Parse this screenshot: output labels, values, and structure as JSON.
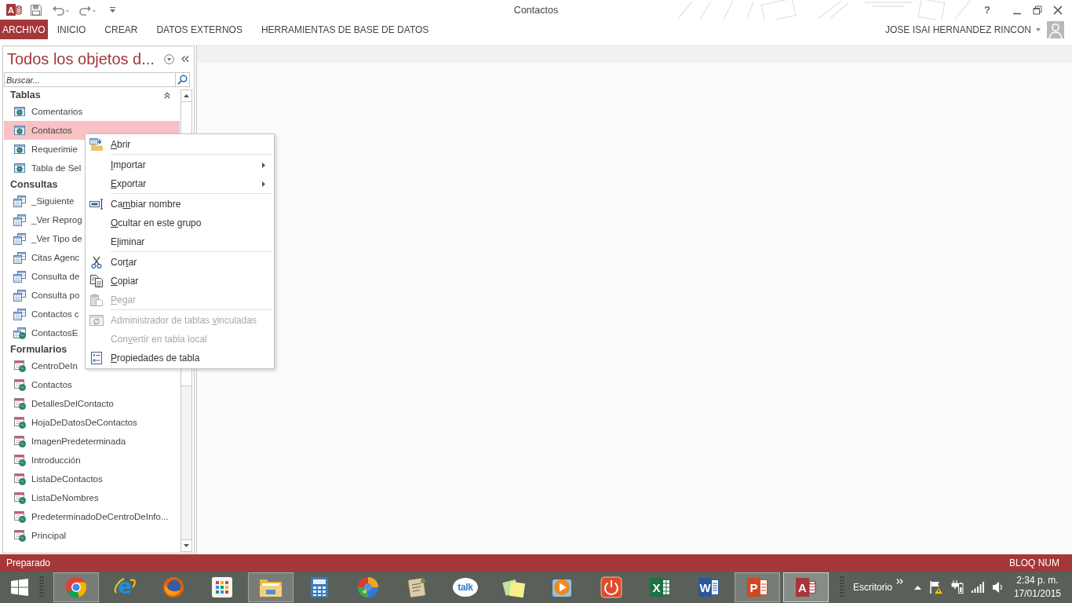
{
  "window": {
    "title": "Contactos",
    "help": "?",
    "app_glyph": "A"
  },
  "ribbon": {
    "tabs": [
      {
        "label": "ARCHIVO",
        "kind": "file"
      },
      {
        "label": "INICIO",
        "kind": "tab"
      },
      {
        "label": "CREAR",
        "kind": "tab"
      },
      {
        "label": "DATOS EXTERNOS",
        "kind": "tab"
      },
      {
        "label": "HERRAMIENTAS DE BASE DE DATOS",
        "kind": "tab"
      }
    ],
    "user": "JOSE ISAI HERNANDEZ RINCON"
  },
  "nav_pane": {
    "title": "Todos los objetos d...",
    "search": {
      "placeholder": "Buscar..."
    },
    "groups": [
      {
        "title": "Tablas",
        "hovered": true,
        "items": [
          {
            "label": "Comentarios",
            "kind": "table",
            "selected": false
          },
          {
            "label": "Contactos",
            "kind": "table",
            "selected": true
          },
          {
            "label": "Requerimie",
            "kind": "table",
            "selected": false
          },
          {
            "label": "Tabla de Sel",
            "kind": "table",
            "selected": false
          }
        ]
      },
      {
        "title": "Consultas",
        "items": [
          {
            "label": "_Siguiente",
            "kind": "query",
            "selected": false
          },
          {
            "label": "_Ver Reprog",
            "kind": "query",
            "selected": false
          },
          {
            "label": "_Ver Tipo de",
            "kind": "query",
            "selected": false
          },
          {
            "label": "Citas Agenc",
            "kind": "query",
            "selected": false
          },
          {
            "label": "Consulta de",
            "kind": "query",
            "selected": false
          },
          {
            "label": "Consulta po",
            "kind": "query",
            "selected": false
          },
          {
            "label": "Contactos c",
            "kind": "query",
            "selected": false
          },
          {
            "label": "ContactosE",
            "kind": "linked",
            "selected": false
          }
        ]
      },
      {
        "title": "Formularios",
        "items": [
          {
            "label": "CentroDeIn",
            "kind": "form",
            "selected": false
          },
          {
            "label": "Contactos",
            "kind": "form",
            "selected": false
          },
          {
            "label": "DetallesDelContacto",
            "kind": "form",
            "selected": false
          },
          {
            "label": "HojaDeDatosDeContactos",
            "kind": "form",
            "selected": false
          },
          {
            "label": "ImagenPredeterminada",
            "kind": "form",
            "selected": false
          },
          {
            "label": "Introducción",
            "kind": "form",
            "selected": false
          },
          {
            "label": "ListaDeContactos",
            "kind": "form",
            "selected": false
          },
          {
            "label": "ListaDeNombres",
            "kind": "form",
            "selected": false
          },
          {
            "label": "PredeterminadoDeCentroDeInfo...",
            "kind": "form",
            "selected": false
          },
          {
            "label": "Principal",
            "kind": "form",
            "selected": false
          }
        ]
      }
    ]
  },
  "context_menu": {
    "sections": [
      [
        {
          "key": "A",
          "after": "brir",
          "disabled": false,
          "has_submenu": false
        }
      ],
      [
        {
          "key": "I",
          "after": "mportar",
          "disabled": false,
          "has_submenu": true
        },
        {
          "key": "E",
          "after": "xportar",
          "disabled": false,
          "has_submenu": true
        }
      ],
      [
        {
          "before": "Ca",
          "key": "m",
          "after": "biar nombre",
          "disabled": false,
          "has_submenu": false
        },
        {
          "key": "O",
          "after": "cultar en este grupo",
          "disabled": false,
          "has_submenu": false
        },
        {
          "before": "E",
          "key": "l",
          "after": "iminar",
          "disabled": false,
          "has_submenu": false
        }
      ],
      [
        {
          "before": "Cor",
          "key": "t",
          "after": "ar",
          "disabled": false,
          "has_submenu": false
        },
        {
          "key": "C",
          "after": "opiar",
          "disabled": false,
          "has_submenu": false
        },
        {
          "key": "P",
          "after": "egar",
          "disabled": true,
          "has_submenu": false
        }
      ],
      [
        {
          "before": "Administrador de tablas ",
          "key": "v",
          "after": "inculadas",
          "disabled": true,
          "has_submenu": false
        },
        {
          "before": "Con",
          "key": "v",
          "after": "ertir en tabla local",
          "disabled": true,
          "has_submenu": false
        },
        {
          "key": "P",
          "after": "ropiedades de tabla",
          "disabled": false,
          "has_submenu": false
        }
      ]
    ]
  },
  "status_bar": {
    "left": "Preparado",
    "right": "BLOQ NUM"
  },
  "taskbar": {
    "apps": [
      {
        "running": true,
        "active": false
      },
      {
        "running": false,
        "active": false,
        "glyph": "e"
      },
      {
        "running": false,
        "active": false
      },
      {
        "running": false,
        "active": false
      },
      {
        "running": true,
        "active": false
      },
      {
        "running": false,
        "active": false
      },
      {
        "running": false,
        "active": false
      },
      {
        "running": false,
        "active": false
      },
      {
        "running": false,
        "active": false,
        "glyph": "talk"
      },
      {
        "running": false,
        "active": false
      },
      {
        "running": false,
        "active": false
      },
      {
        "running": false,
        "active": false
      },
      {
        "running": false,
        "active": false,
        "glyph": "X"
      },
      {
        "running": false,
        "active": false,
        "glyph": "W"
      },
      {
        "running": true,
        "active": false,
        "glyph": "P"
      },
      {
        "running": true,
        "active": true,
        "glyph": "A"
      }
    ],
    "desktop_label": "Escritorio",
    "clock": {
      "time": "2:34 p. m.",
      "date": "17/01/2015"
    }
  }
}
